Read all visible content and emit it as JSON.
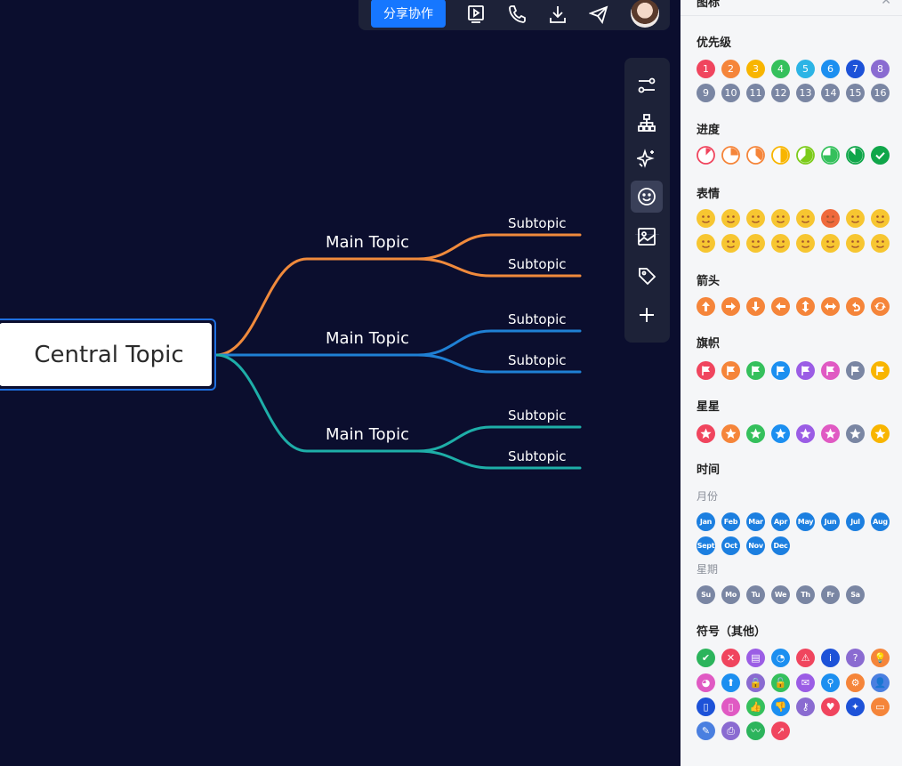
{
  "toolbar": {
    "share_label": "分享协作",
    "icons": [
      "present-icon",
      "phone-icon",
      "download-icon",
      "send-icon"
    ]
  },
  "mindmap": {
    "central": "Central Topic",
    "branches": [
      {
        "label": "Main Topic",
        "color": "#f08a3c",
        "subtopics": [
          "Subtopic",
          "Subtopic"
        ]
      },
      {
        "label": "Main Topic",
        "color": "#1f80d4",
        "subtopics": [
          "Subtopic",
          "Subtopic"
        ]
      },
      {
        "label": "Main Topic",
        "color": "#1eaea8",
        "subtopics": [
          "Subtopic",
          "Subtopic"
        ]
      }
    ]
  },
  "side_toolbar": [
    "style-sliders-icon",
    "structure-icon",
    "ai-sparkle-icon",
    "emoji-icon",
    "image-icon",
    "tag-icon",
    "add-icon"
  ],
  "panel": {
    "title": "图标",
    "sections": {
      "priority": "优先级",
      "progress": "进度",
      "emotion": "表情",
      "arrow": "箭头",
      "flag": "旗帜",
      "star": "星星",
      "time": "时间",
      "symbol": "符号（其他）"
    },
    "months_label": "月份",
    "weekdays_label": "星期",
    "priority_items": [
      "1",
      "2",
      "3",
      "4",
      "5",
      "6",
      "7",
      "8",
      "9",
      "10",
      "11",
      "12",
      "13",
      "14",
      "15",
      "16"
    ],
    "priority_colors": [
      "#f0455e",
      "#f5853a",
      "#f8b500",
      "#35c05c",
      "#2cb4e5",
      "#1c8ff0",
      "#1d52d8",
      "#8a6bd1",
      "#7a86a3",
      "#7a86a3",
      "#7a86a3",
      "#7a86a3",
      "#7a86a3",
      "#7a86a3",
      "#7a86a3",
      "#7a86a3"
    ],
    "months": [
      "Jan",
      "Feb",
      "Mar",
      "Apr",
      "May",
      "Jun",
      "Jul",
      "Aug",
      "Sept",
      "Oct",
      "Nov",
      "Dec"
    ],
    "weekdays": [
      "Su",
      "Mo",
      "Tu",
      "We",
      "Th",
      "Fr",
      "Sa"
    ],
    "flag_colors": [
      "#f0455e",
      "#f5853a",
      "#35c05c",
      "#1c8ff0",
      "#9b5de5",
      "#e05ac3",
      "#7a86a3",
      "#f8b500"
    ],
    "star_colors": [
      "#f0455e",
      "#f5853a",
      "#35c05c",
      "#1c8ff0",
      "#9b5de5",
      "#e05ac3",
      "#7a86a3",
      "#f8b500"
    ],
    "progress_fractions": [
      0.125,
      0.25,
      0.375,
      0.5,
      0.625,
      0.75,
      0.875,
      1
    ],
    "symbol_colors": [
      "#2cb45c",
      "#f0455e",
      "#9b5de5",
      "#1c8ff0",
      "#f0455e",
      "#1d52d8",
      "#8a6bd1",
      "#f5853a",
      "#e05ac3",
      "#1c8ff0",
      "#8a6bd1",
      "#35c05c",
      "#9b5de5",
      "#1c8ff0",
      "#f5853a",
      "#4a7fe0",
      "#1d52d8",
      "#e05ac3",
      "#35c05c",
      "#1c8ff0",
      "#8a6bd1",
      "#f0455e",
      "#1d52d8",
      "#f5853a",
      "#4a7fe0",
      "#8a6bd1",
      "#2cb45c",
      "#f0455e"
    ]
  }
}
